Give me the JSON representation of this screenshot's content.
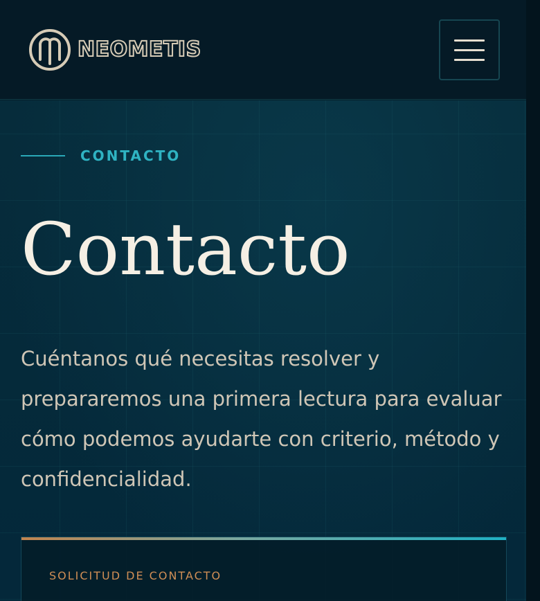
{
  "header": {
    "brand_name": "NEOMETIS",
    "logo_icon": "neometis-logo-icon",
    "menu_icon": "hamburger-menu-icon"
  },
  "hero": {
    "eyebrow": "CONTACTO",
    "title": "Contacto",
    "lead": "Cuéntanos qué necesitas resolver y prepararemos una primera lectura para evaluar cómo podemos ayudarte con criterio, método y confidencialidad."
  },
  "contact_form": {
    "label": "SOLICITUD DE CONTACTO"
  },
  "colors": {
    "background": "#04202c",
    "header": "#051a26",
    "accent_teal": "#2fb3c2",
    "accent_copper": "#d08e55",
    "title": "#f5efe4",
    "body_text": "#cfc6b6"
  }
}
